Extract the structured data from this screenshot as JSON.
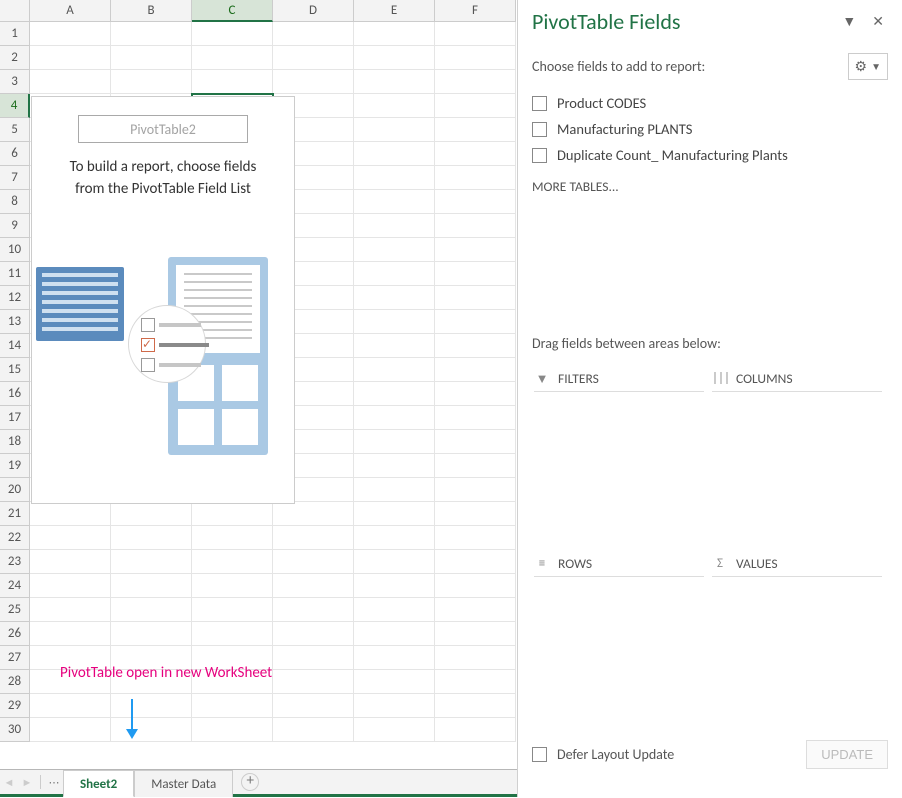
{
  "grid": {
    "columns": [
      "A",
      "B",
      "C",
      "D",
      "E",
      "F"
    ],
    "rows": [
      "1",
      "2",
      "3",
      "4",
      "5",
      "6",
      "7",
      "8",
      "9",
      "10",
      "11",
      "12",
      "13",
      "14",
      "15",
      "16",
      "17",
      "18",
      "19",
      "20",
      "21",
      "22",
      "23",
      "24",
      "25",
      "26",
      "27",
      "28",
      "29",
      "30"
    ],
    "active_col": "C",
    "active_row": "4"
  },
  "pivot_placeholder": {
    "title": "PivotTable2",
    "message_line1": "To build a report, choose fields",
    "message_line2": "from the PivotTable Field List"
  },
  "annotation": "PivotTable open in new WorkSheet",
  "tabs": {
    "items": [
      {
        "label": "Sheet2",
        "active": true
      },
      {
        "label": "Master Data",
        "active": false
      }
    ]
  },
  "taskpane": {
    "title": "PivotTable Fields",
    "subtitle": "Choose fields to add to report:",
    "fields": [
      {
        "label": "Product CODES"
      },
      {
        "label": "Manufacturing PLANTS"
      },
      {
        "label": "Duplicate Count_ Manufacturing Plants"
      }
    ],
    "more_tables": "MORE TABLES...",
    "area_hint": "Drag fields between areas below:",
    "areas": {
      "filters": "FILTERS",
      "columns": "COLUMNS",
      "rows": "ROWS",
      "values": "VALUES"
    },
    "defer_label": "Defer Layout Update",
    "update_label": "UPDATE"
  }
}
